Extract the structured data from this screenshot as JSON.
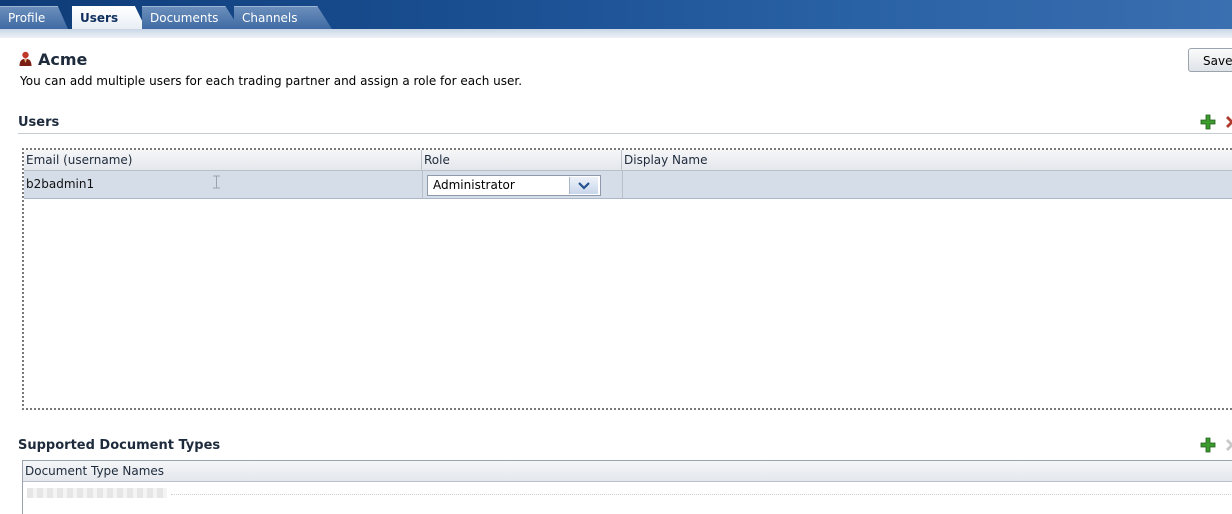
{
  "tabs": [
    {
      "label": "Profile",
      "active": false
    },
    {
      "label": "Users",
      "active": true
    },
    {
      "label": "Documents",
      "active": false
    },
    {
      "label": "Channels",
      "active": false
    }
  ],
  "header": {
    "title": "Acme",
    "title_icon": "person-icon",
    "description": "You can add multiple users for each trading partner and assign a role for each user.",
    "save_label": "Save"
  },
  "users_section": {
    "title": "Users",
    "add_icon": "add-icon",
    "delete_icon": "delete-icon",
    "columns": [
      "Email (username)",
      "Role",
      "Display Name"
    ],
    "rows": [
      {
        "email": "b2badmin1",
        "role": "Administrator",
        "display_name": ""
      }
    ]
  },
  "doc_types_section": {
    "title": "Supported Document Types",
    "add_icon": "add-icon",
    "delete_icon": "delete-icon",
    "columns": [
      "Document Type Names"
    ]
  },
  "colors": {
    "tabbar": "#184d8f",
    "selected_row": "#d5dde8",
    "add_icon": "#3c9a2e",
    "delete_icon": "#b03a2e"
  }
}
